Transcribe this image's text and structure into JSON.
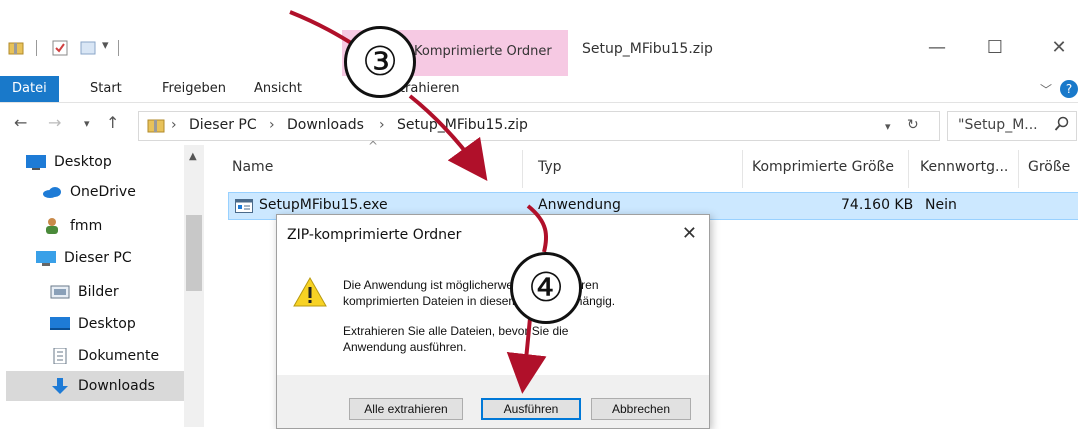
{
  "window": {
    "tool_tab": "Komprimierte Ordner",
    "title": "Setup_MFibu15.zip"
  },
  "ribbon": {
    "tabs": [
      "Datei",
      "Start",
      "Freigeben",
      "Ansicht",
      "Extrahieren"
    ]
  },
  "address": {
    "crumbs": [
      "Dieser PC",
      "Downloads",
      "Setup_MFibu15.zip"
    ],
    "search_placeholder": "\"Setup_M..."
  },
  "nav": {
    "items": [
      "Desktop",
      "OneDrive",
      "fmm",
      "Dieser PC",
      "Bilder",
      "Desktop",
      "Dokumente",
      "Downloads"
    ],
    "selected": "Downloads"
  },
  "list": {
    "columns": [
      "Name",
      "Typ",
      "Komprimierte Größe",
      "Kennwortg...",
      "Größe"
    ],
    "rows": [
      {
        "name": "SetupMFibu15.exe",
        "type": "Anwendung",
        "compressed": "74.160 KB",
        "password": "Nein"
      }
    ]
  },
  "dialog": {
    "title": "ZIP-komprimierte Ordner",
    "message_lines": [
      "Die Anwendung ist möglicherweise von anderen",
      "komprimierten Dateien in diesem Ordner abhängig."
    ],
    "message2_lines": [
      "Extrahieren Sie alle Dateien, bevor Sie die",
      "Anwendung ausführen."
    ],
    "buttons": [
      "Alle extrahieren",
      "Ausführen",
      "Abbrechen"
    ]
  },
  "annotations": {
    "step3": "③",
    "step4": "④",
    "arrow_color": "#b0102a"
  },
  "colors": {
    "accent": "#1979ca",
    "tool_tab": "#f6c9e3",
    "selection": "#cce8ff"
  }
}
